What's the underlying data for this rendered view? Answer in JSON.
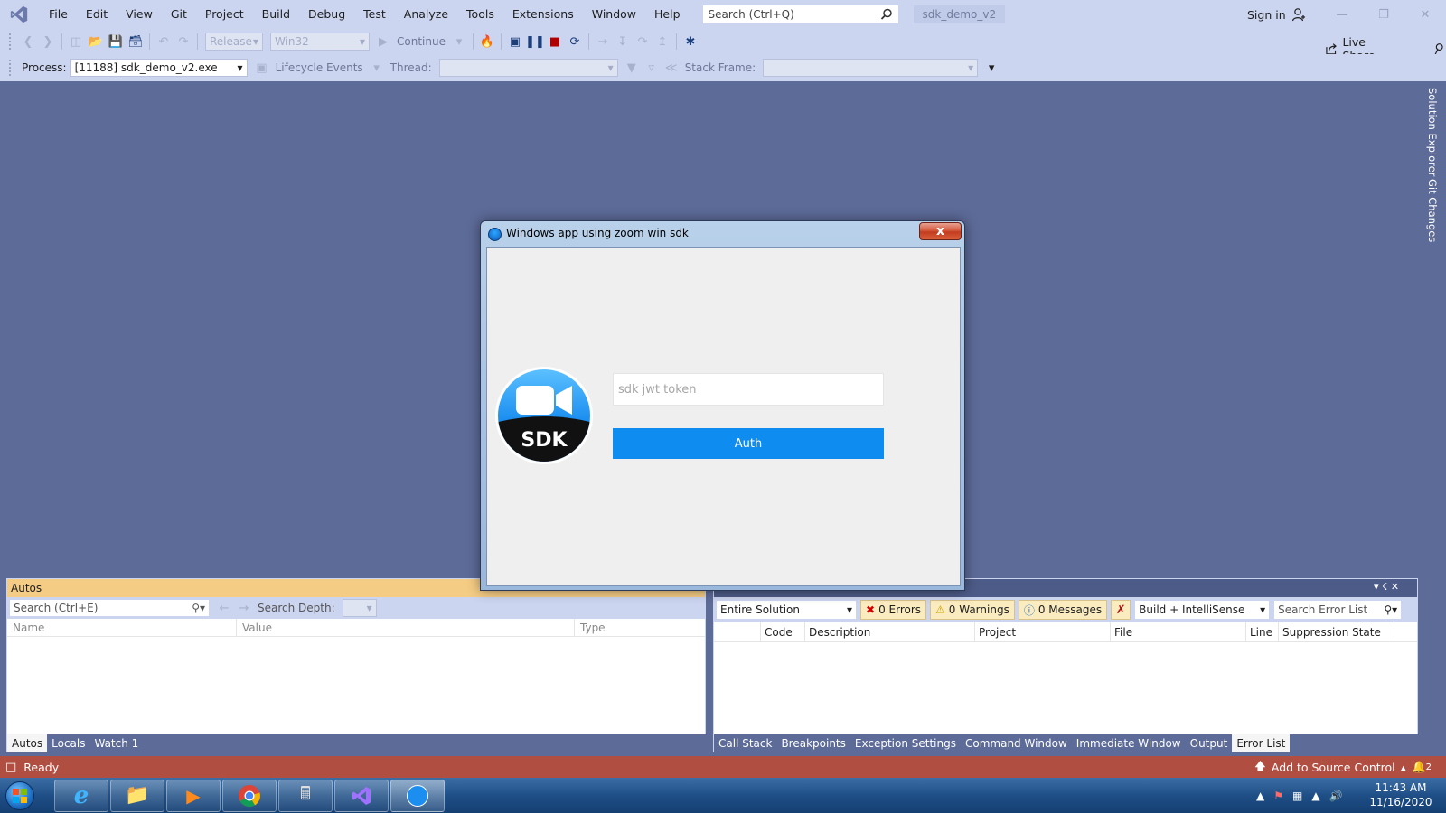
{
  "menu": {
    "items": [
      "File",
      "Edit",
      "View",
      "Git",
      "Project",
      "Build",
      "Debug",
      "Test",
      "Analyze",
      "Tools",
      "Extensions",
      "Window",
      "Help"
    ],
    "search_placeholder": "Search (Ctrl+Q)",
    "solution_name": "sdk_demo_v2",
    "sign_in": "Sign in"
  },
  "toolbar": {
    "config": "Release",
    "platform": "Win32",
    "continue_label": "Continue",
    "live_share": "Live Share"
  },
  "debug_location": {
    "process_label": "Process:",
    "process_value": "[11188] sdk_demo_v2.exe",
    "lifecycle_label": "Lifecycle Events",
    "thread_label": "Thread:",
    "stack_frame_label": "Stack Frame:"
  },
  "right_rail": {
    "tabs": [
      "Solution Explorer",
      "Git Changes"
    ]
  },
  "dialog": {
    "title": "Windows app using zoom win sdk",
    "close_glyph": "x",
    "logo_text": "SDK",
    "token_placeholder": "sdk jwt token",
    "token_value": "",
    "auth_label": "Auth"
  },
  "autos": {
    "title": "Autos",
    "search_placeholder": "Search (Ctrl+E)",
    "search_depth_label": "Search Depth:",
    "columns": [
      "Name",
      "Value",
      "Type"
    ],
    "tabs": [
      "Autos",
      "Locals",
      "Watch 1"
    ],
    "active_tab": "Autos"
  },
  "error_list": {
    "scope": "Entire Solution",
    "errors": "0 Errors",
    "warnings": "0 Warnings",
    "messages": "0 Messages",
    "build_filter": "Build + IntelliSense",
    "search_placeholder": "Search Error List",
    "columns": [
      "",
      "Code",
      "Description",
      "Project",
      "File",
      "Line",
      "Suppression State"
    ],
    "tabs": [
      "Call Stack",
      "Breakpoints",
      "Exception Settings",
      "Command Window",
      "Immediate Window",
      "Output",
      "Error List"
    ],
    "active_tab": "Error List"
  },
  "status": {
    "ready": "Ready",
    "source_control": "Add to Source Control",
    "notifications": "2"
  },
  "taskbar": {
    "time": "11:43 AM",
    "date": "11/16/2020"
  },
  "colors": {
    "ide_background": "#5d6b99",
    "toolbar": "#ccd5f0",
    "status_bar": "#b04e41",
    "auth_button": "#0e8cf0",
    "autos_header": "#f5cc84"
  }
}
